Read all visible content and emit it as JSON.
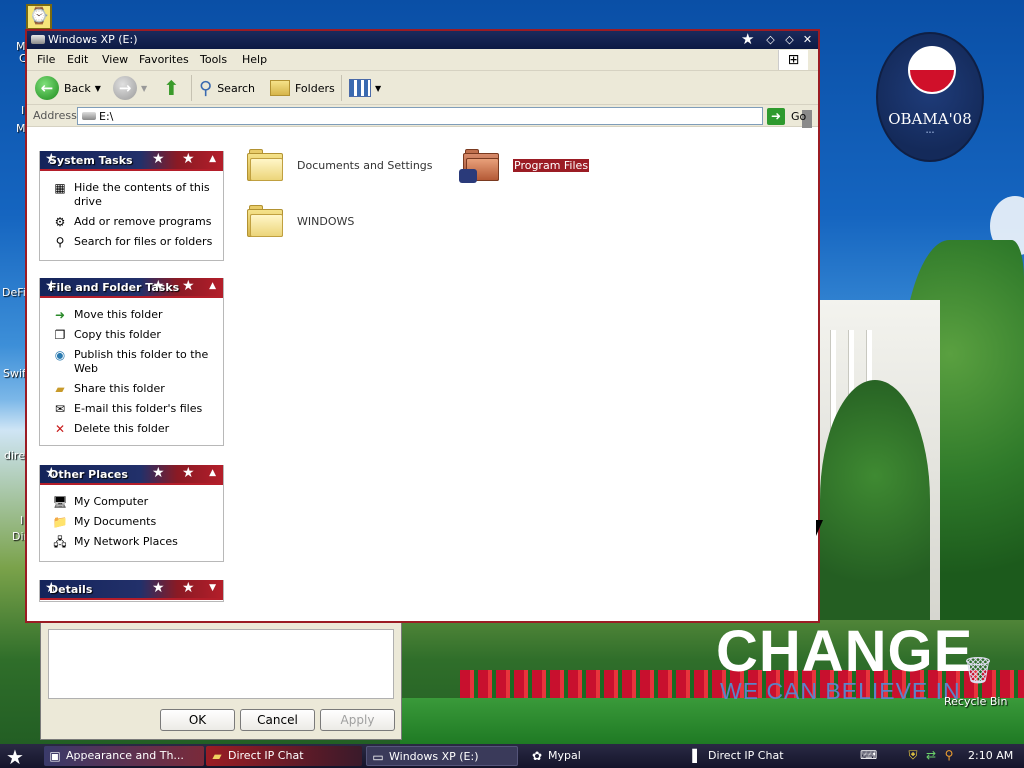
{
  "window": {
    "title": "Windows XP (E:)",
    "menu": [
      "File",
      "Edit",
      "View",
      "Favorites",
      "Tools",
      "Help"
    ],
    "toolbar": {
      "back": "Back",
      "search": "Search",
      "folders": "Folders"
    },
    "address": {
      "label": "Address",
      "value": "E:\\",
      "go": "Go"
    }
  },
  "taskpane": {
    "system_tasks": {
      "title": "System Tasks",
      "items": [
        "Hide the contents of this drive",
        "Add or remove programs",
        "Search for files or folders"
      ]
    },
    "file_folder_tasks": {
      "title": "File and Folder Tasks",
      "items": [
        "Move this folder",
        "Copy this folder",
        "Publish this folder to the Web",
        "Share this folder",
        "E-mail this folder's files",
        "Delete this folder"
      ]
    },
    "other_places": {
      "title": "Other Places",
      "items": [
        "My Computer",
        "My Documents",
        "My Network Places"
      ]
    },
    "details": {
      "title": "Details"
    }
  },
  "content": {
    "items": [
      {
        "name": "Documents and Settings",
        "selected": false
      },
      {
        "name": "Program Files",
        "selected": true
      },
      {
        "name": "WINDOWS",
        "selected": false
      }
    ]
  },
  "background_dialog": {
    "ok": "OK",
    "cancel": "Cancel",
    "apply": "Apply"
  },
  "desktop": {
    "logo_text": "OBAMA'08",
    "slogan_big": "CHANGE",
    "slogan_small": "WE CAN BELIEVE IN",
    "recycle_bin": "Recycle Bin",
    "left_labels": [
      "M",
      "C",
      "I",
      "M",
      "DeFi",
      "Swifi",
      "direc",
      "I",
      "Din"
    ]
  },
  "taskbar": {
    "buttons": [
      "Appearance and Th...",
      "Direct IP Chat",
      "Windows XP (E:)",
      "Mypal",
      "Direct IP Chat"
    ],
    "clock": "2:10 AM"
  },
  "colors": {
    "accent_red": "#9b1c24",
    "navy": "#14245a",
    "selection": "#9b1c24"
  }
}
